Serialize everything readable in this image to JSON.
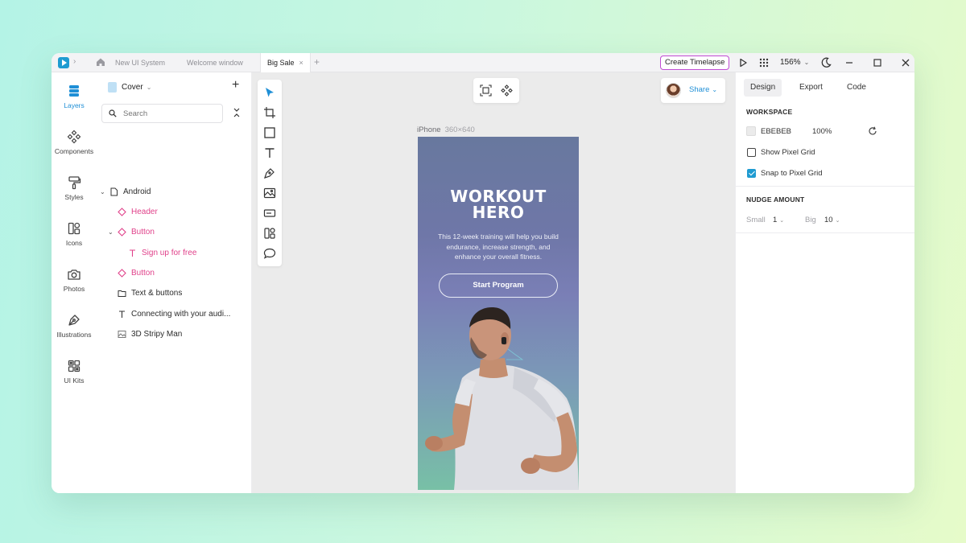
{
  "titlebar": {
    "tabs": [
      "New UI System",
      "Welcome window",
      "Big Sale"
    ],
    "active_tab": "Big Sale",
    "close_symbol": "×",
    "add_symbol": "+",
    "timelapse_label": "Create Timelapse",
    "zoom": "156%",
    "accent": "#c04bd3"
  },
  "rail": {
    "items": [
      {
        "label": "Layers",
        "icon": "layers-icon"
      },
      {
        "label": "Components",
        "icon": "components-icon"
      },
      {
        "label": "Styles",
        "icon": "styles-icon"
      },
      {
        "label": "Icons",
        "icon": "icons-icon"
      },
      {
        "label": "Photos",
        "icon": "camera-icon"
      },
      {
        "label": "Illustrations",
        "icon": "pen-nib-icon"
      },
      {
        "label": "UI Kits",
        "icon": "ui-kits-icon"
      }
    ],
    "active_color": "#1f8fd6"
  },
  "layers": {
    "page": "Cover",
    "search_placeholder": "Search",
    "rows": [
      {
        "label": "Android",
        "icon": "page-icon"
      },
      {
        "label": "Header",
        "icon": "component-icon"
      },
      {
        "label": "Button",
        "icon": "component-icon"
      },
      {
        "label": "Sign up for free",
        "icon": "text-icon"
      },
      {
        "label": "Button",
        "icon": "component-icon"
      },
      {
        "label": "Text & buttons",
        "icon": "folder-icon"
      },
      {
        "label": "Connecting with your audi...",
        "icon": "text-icon"
      },
      {
        "label": "3D Stripy Man",
        "icon": "image-icon"
      }
    ],
    "component_color": "#e0418a"
  },
  "canvas": {
    "background": "#EBEBEB",
    "frame_name": "iPhone",
    "frame_size": "360×640",
    "share_label": "Share",
    "hero": {
      "title_line1": "WORKOUT",
      "title_line2": "HERO",
      "description": "This 12-week training will help you build endurance, increase strength, and enhance your overall fitness.",
      "button": "Start Program"
    }
  },
  "props": {
    "tabs": [
      "Design",
      "Export",
      "Code"
    ],
    "active_tab": "Design",
    "workspace_title": "WORKSPACE",
    "workspace_color": "EBEBEB",
    "workspace_opacity": "100%",
    "show_pixel_grid": "Show Pixel Grid",
    "snap_to_pixel_grid": "Snap to Pixel Grid",
    "nudge_title": "NUDGE AMOUNT",
    "small_label": "Small",
    "small_value": "1",
    "big_label": "Big",
    "big_value": "10"
  }
}
